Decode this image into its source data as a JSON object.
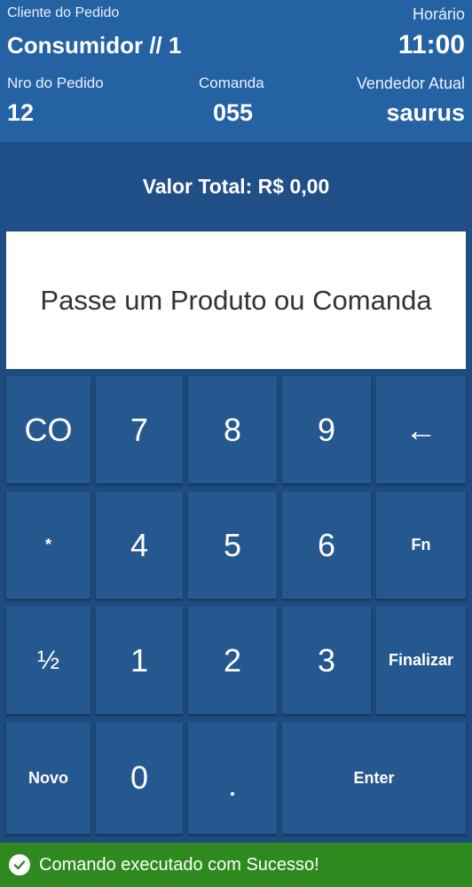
{
  "header": {
    "cliente_label": "Cliente do Pedido",
    "cliente_value": "Consumidor // 1",
    "horario_label": "Horário",
    "horario_value": "11:00",
    "pedido_label": "Nro do Pedido",
    "pedido_value": "12",
    "comanda_label": "Comanda",
    "comanda_value": "055",
    "vendedor_label": "Vendedor Atual",
    "vendedor_value": "saurus"
  },
  "total": {
    "text": "Valor Total: R$ 0,00"
  },
  "input": {
    "prompt": "Passe um Produto ou Comanda"
  },
  "keypad": {
    "co": "CO",
    "k7": "7",
    "k8": "8",
    "k9": "9",
    "back": "←",
    "star": "*",
    "k4": "4",
    "k5": "5",
    "k6": "6",
    "fn": "Fn",
    "half": "½",
    "k1": "1",
    "k2": "2",
    "k3": "3",
    "finalizar": "Finalizar",
    "novo": "Novo",
    "k0": "0",
    "dot": ".",
    "enter": "Enter"
  },
  "status": {
    "message": "Comando executado com Sucesso!"
  },
  "colors": {
    "header_bg": "#2462a4",
    "background": "#1f4f86",
    "key_bg": "#25588f",
    "success": "#2e8a1f"
  }
}
